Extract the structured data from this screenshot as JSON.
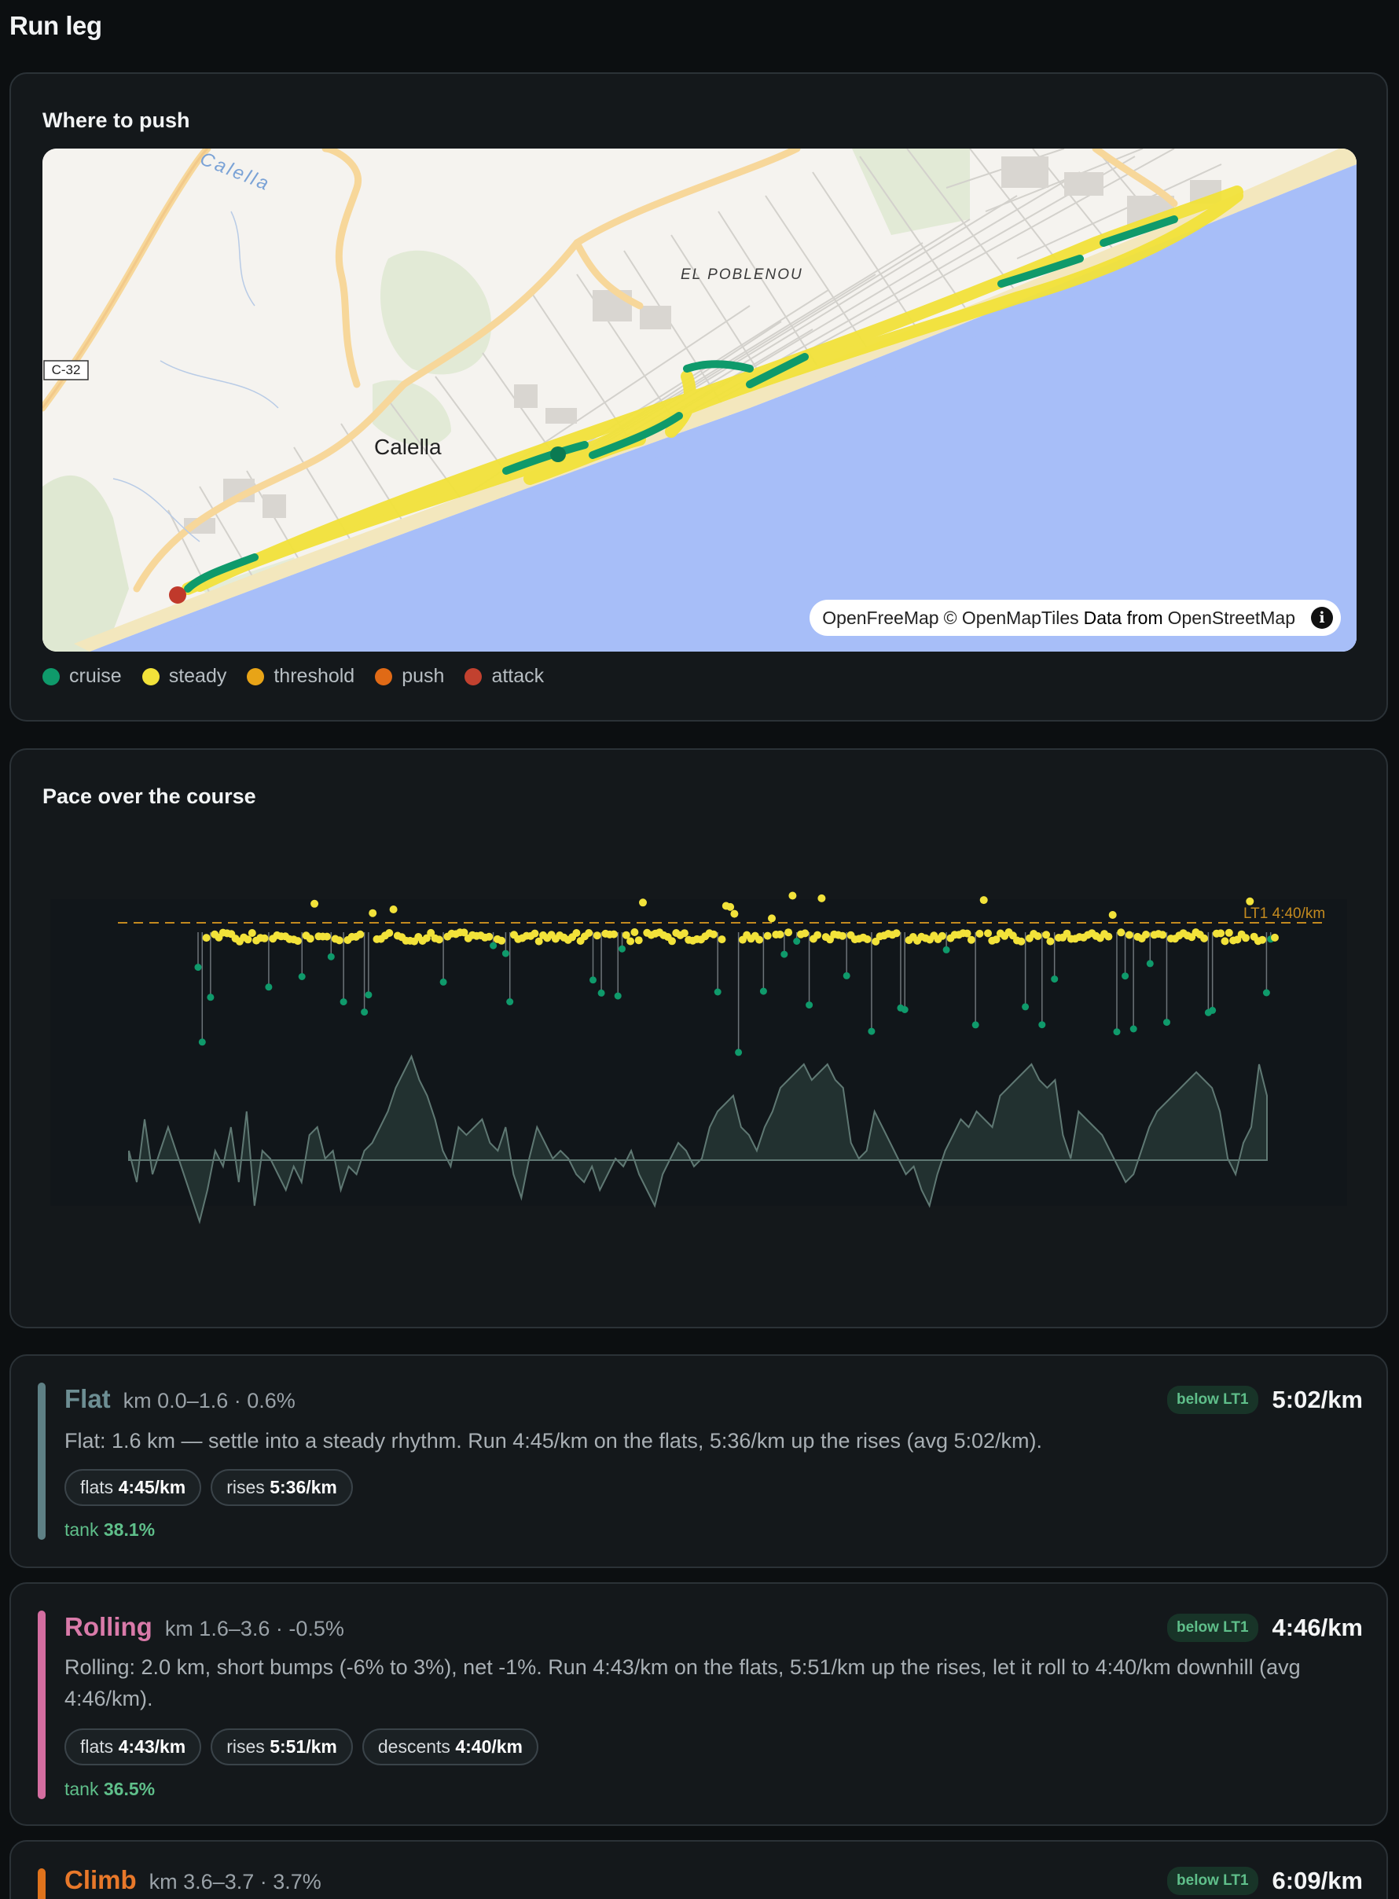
{
  "page": {
    "title": "Run leg"
  },
  "map_card": {
    "title": "Where to push",
    "labels": {
      "town": "Calella",
      "district": "EL POBLENOU",
      "road_shield": "C-32",
      "river": "Calella"
    },
    "attribution": {
      "part1": "OpenFreeMap",
      "part2": "© OpenMapTiles",
      "part3": "Data from",
      "part4": "OpenStreetMap",
      "info": "i"
    },
    "legend": [
      {
        "label": "cruise",
        "color": "#0f9a6b"
      },
      {
        "label": "steady",
        "color": "#f2e23a"
      },
      {
        "label": "threshold",
        "color": "#e8a417"
      },
      {
        "label": "push",
        "color": "#e06a16"
      },
      {
        "label": "attack",
        "color": "#c2412f"
      }
    ]
  },
  "pace_card": {
    "title": "Pace over the course",
    "threshold_label": "LT1 4:40/km",
    "colors": {
      "steady": "#f2e23a",
      "cruise": "#0f9a6b",
      "threshold_line": "#c38a1f",
      "elevation_fill": "#233230",
      "elevation_line": "#5f7873"
    }
  },
  "segments": [
    {
      "name": "Flat",
      "color": "#5e8085",
      "meta": "km 0.0–1.6 · 0.6%",
      "badge": "below LT1",
      "pace": "5:02/km",
      "desc": "Flat: 1.6 km — settle into a steady rhythm. Run 4:45/km on the flats, 5:36/km up the rises (avg 5:02/km).",
      "chips": [
        {
          "label": "flats",
          "value": "4:45/km"
        },
        {
          "label": "rises",
          "value": "5:36/km"
        }
      ],
      "tank_label": "tank",
      "tank_value": "38.1%"
    },
    {
      "name": "Rolling",
      "color": "#d46da0",
      "meta": "km 1.6–3.6 · -0.5%",
      "badge": "below LT1",
      "pace": "4:46/km",
      "desc": "Rolling: 2.0 km, short bumps (-6% to 3%), net -1%. Run 4:43/km on the flats, 5:51/km up the rises, let it roll to 4:40/km downhill (avg 4:46/km).",
      "chips": [
        {
          "label": "flats",
          "value": "4:43/km"
        },
        {
          "label": "rises",
          "value": "5:51/km"
        },
        {
          "label": "descents",
          "value": "4:40/km"
        }
      ],
      "tank_label": "tank",
      "tank_value": "36.5%"
    },
    {
      "name": "Climb",
      "color": "#e0731c",
      "meta": "km 3.6–3.7 · 3.7%",
      "badge": "below LT1",
      "pace": "6:09/km"
    }
  ]
}
